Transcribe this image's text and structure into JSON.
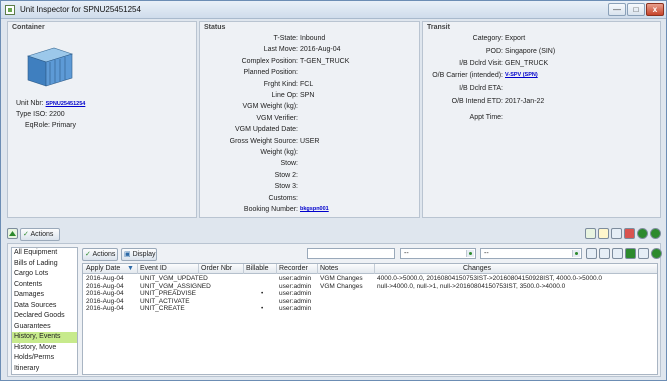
{
  "window": {
    "title": "Unit Inspector for SPNU25451254",
    "minimize": "—",
    "maximize": "□",
    "close": "x"
  },
  "container": {
    "section_title": "Container",
    "unit_nbr_label": "Unit Nbr:",
    "unit_nbr_value": "SPNU25451254",
    "type_iso_label": "Type ISO:",
    "type_iso_value": "2200",
    "eqrole_label": "EqRole:",
    "eqrole_value": "Primary"
  },
  "status": {
    "section_title": "Status",
    "rows": [
      {
        "label": "T-State:",
        "value": "Inbound"
      },
      {
        "label": "Last Move:",
        "value": "2016-Aug-04"
      },
      {
        "label": "Complex Position:",
        "value": "T-GEN_TRUCK"
      },
      {
        "label": "Planned Position:",
        "value": ""
      },
      {
        "label": "Frght Kind:",
        "value": "FCL"
      },
      {
        "label": "Line Op:",
        "value": "SPN"
      },
      {
        "label": "VGM Weight (kg):",
        "value": ""
      },
      {
        "label": "VGM Verifier:",
        "value": ""
      },
      {
        "label": "VGM Updated Date:",
        "value": ""
      },
      {
        "label": "Gross Weight Source:",
        "value": "USER"
      },
      {
        "label": "Weight (kg):",
        "value": ""
      },
      {
        "label": "Stow:",
        "value": ""
      },
      {
        "label": "Stow 2:",
        "value": ""
      },
      {
        "label": "Stow 3:",
        "value": ""
      },
      {
        "label": "Customs:",
        "value": ""
      },
      {
        "label": "Booking Number:",
        "value": "bkgspn001"
      }
    ]
  },
  "transit": {
    "section_title": "Transit",
    "rows": [
      {
        "label": "Category:",
        "value": "Export"
      },
      {
        "label": "POD:",
        "value": "Singapore (SIN)"
      },
      {
        "label": "I/B Dclrd Visit:",
        "value": "GEN_TRUCK"
      },
      {
        "label": "O/B Carrier (intended):",
        "value": "V-SPV (SPN)"
      },
      {
        "label": "I/B Dclrd ETA:",
        "value": ""
      },
      {
        "label": "O/B Intend ETD:",
        "value": "2017-Jan-22"
      },
      {
        "label": "Appt Time:",
        "value": ""
      }
    ]
  },
  "toolbar": {
    "actions_label": "Actions"
  },
  "lower": {
    "actions_label": "Actions",
    "display_label": "Display",
    "filter_value": "",
    "combo1_value": "--",
    "combo2_value": "--",
    "side_items": [
      "All Equipment",
      "Bills of Lading",
      "Cargo Lots",
      "Contents",
      "Damages",
      "Data Sources",
      "Declared Goods",
      "Guarantees",
      "History, Events",
      "History, Move",
      "Holds/Perms",
      "Itinerary"
    ],
    "selected_index": 8,
    "columns": [
      "Apply Date",
      "Event ID",
      "Order Nbr",
      "Billable",
      "Recorder",
      "Notes",
      "Changes"
    ],
    "rows": [
      {
        "apply_date": "2016-Aug-04",
        "event_id": "UNIT_VGM_UPDATED",
        "order_nbr": "",
        "billable": "",
        "recorder": "user:admin",
        "notes": "VGM Changes",
        "changes": "4000.0->5000.0, 20160804150753IST->20160804150928IST, 4000.0->5000.0"
      },
      {
        "apply_date": "2016-Aug-04",
        "event_id": "UNIT_VGM_ASSIGNED",
        "order_nbr": "",
        "billable": "",
        "recorder": "user:admin",
        "notes": "VGM Changes",
        "changes": "null->4000.0, null->1, null->20160804150753IST, 3500.0->4000.0"
      },
      {
        "apply_date": "2016-Aug-04",
        "event_id": "UNIT_PREADVISE",
        "order_nbr": "",
        "billable": "•",
        "recorder": "user:admin",
        "notes": "",
        "changes": ""
      },
      {
        "apply_date": "2016-Aug-04",
        "event_id": "UNIT_ACTIVATE",
        "order_nbr": "",
        "billable": "",
        "recorder": "user:admin",
        "notes": "",
        "changes": ""
      },
      {
        "apply_date": "2016-Aug-04",
        "event_id": "UNIT_CREATE",
        "order_nbr": "",
        "billable": "•",
        "recorder": "user:admin",
        "notes": "",
        "changes": ""
      }
    ]
  },
  "colors": {
    "selected_row": "#c7ea8c",
    "link": "#0000cc",
    "close_button": "#c6442b"
  }
}
